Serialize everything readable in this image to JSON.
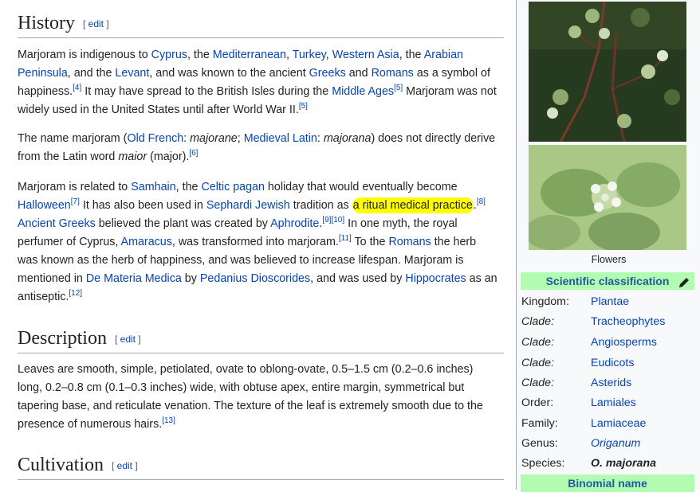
{
  "edit_label": "edit",
  "sections": {
    "history": {
      "title": "History",
      "p1": {
        "t1": "Marjoram is indigenous to ",
        "l1": "Cyprus",
        "t2": ", the ",
        "l2": "Mediterranean",
        "t3": ", ",
        "l3": "Turkey",
        "t4": ", ",
        "l4": "Western Asia",
        "t5": ", the ",
        "l5": "Arabian Peninsula",
        "t6": ", and the ",
        "l6": "Levant",
        "t7": ", and was known to the ancient ",
        "l7": "Greeks",
        "t8": " and ",
        "l8": "Romans",
        "t9": " as a symbol of happiness.",
        "r4": "[4]",
        "t10": " It may have spread to the British Isles during the ",
        "l9": "Middle Ages",
        "r5": "[5]",
        "t11": " Marjoram was not widely used in the United States until after World War II.",
        "r5b": "[5]"
      },
      "p2": {
        "t1": "The name marjoram (",
        "l1": "Old French",
        "t2": ": ",
        "i1": "majorane",
        "t3": "; ",
        "l2": "Medieval Latin",
        "t4": ": ",
        "i2": "majorana",
        "t5": ") does not directly derive from the Latin word ",
        "i3": "maior",
        "t6": " (major).",
        "r6": "[6]"
      },
      "p3": {
        "t1": "Marjoram is related to ",
        "l1": "Samhain",
        "t2": ", the ",
        "l2": "Celtic pagan",
        "t3": " holiday that would eventually become ",
        "l3": "Halloween",
        "r7": "[7]",
        "t4": " It has also been used in ",
        "l4": "Sephardi Jewish",
        "t5": " tradition as ",
        "hl": "a ritual medical practice",
        "t6": ".",
        "r8": "[8]",
        "l5": "Ancient Greeks",
        "t7": " believed the plant was created by ",
        "l6": "Aphrodite",
        "t8": ".",
        "r9": "[9]",
        "r10": "[10]",
        "t9": " In one myth, the royal perfumer of Cyprus, ",
        "l7": "Amaracus",
        "t10": ", was transformed into marjoram.",
        "r11": "[11]",
        "t11": " To the ",
        "l8": "Romans",
        "t12": " the herb was known as the herb of happiness, and was believed to increase lifespan. Marjoram is mentioned in ",
        "l9": "De Materia Medica",
        "t13": " by ",
        "l10": "Pedanius Dioscorides",
        "t14": ", and was used by ",
        "l11": "Hippocrates",
        "t15": " as an antiseptic.",
        "r12": "[12]"
      }
    },
    "description": {
      "title": "Description",
      "p1": {
        "t1": "Leaves are smooth, simple, petiolated, ovate to oblong-ovate, 0.5–1.5 cm (0.2–0.6 inches) long, 0.2–0.8 cm (0.1–0.3 inches) wide, with obtuse apex, entire margin, symmetrical but tapering base, and reticulate venation. The texture of the leaf is extremely smooth due to the presence of numerous hairs.",
        "r13": "[13]"
      }
    },
    "cultivation": {
      "title": "Cultivation"
    }
  },
  "infobox": {
    "caption": "Flowers",
    "sci_header": "Scientific classification",
    "taxonomy": [
      {
        "label": "Kingdom:",
        "value": "Plantae"
      },
      {
        "label": "Clade:",
        "value": "Tracheophytes"
      },
      {
        "label": "Clade:",
        "value": "Angiosperms"
      },
      {
        "label": "Clade:",
        "value": "Eudicots"
      },
      {
        "label": "Clade:",
        "value": "Asterids"
      },
      {
        "label": "Order:",
        "value": "Lamiales"
      },
      {
        "label": "Family:",
        "value": "Lamiaceae"
      },
      {
        "label": "Genus:",
        "value": "Origanum"
      },
      {
        "label": "Species:",
        "value": "O. majorana"
      }
    ],
    "binomial_header": "Binomial name"
  },
  "colors": {
    "link": "#0645ad",
    "highlight": "#ffff00",
    "infobox_header": "#b2fcb2"
  }
}
